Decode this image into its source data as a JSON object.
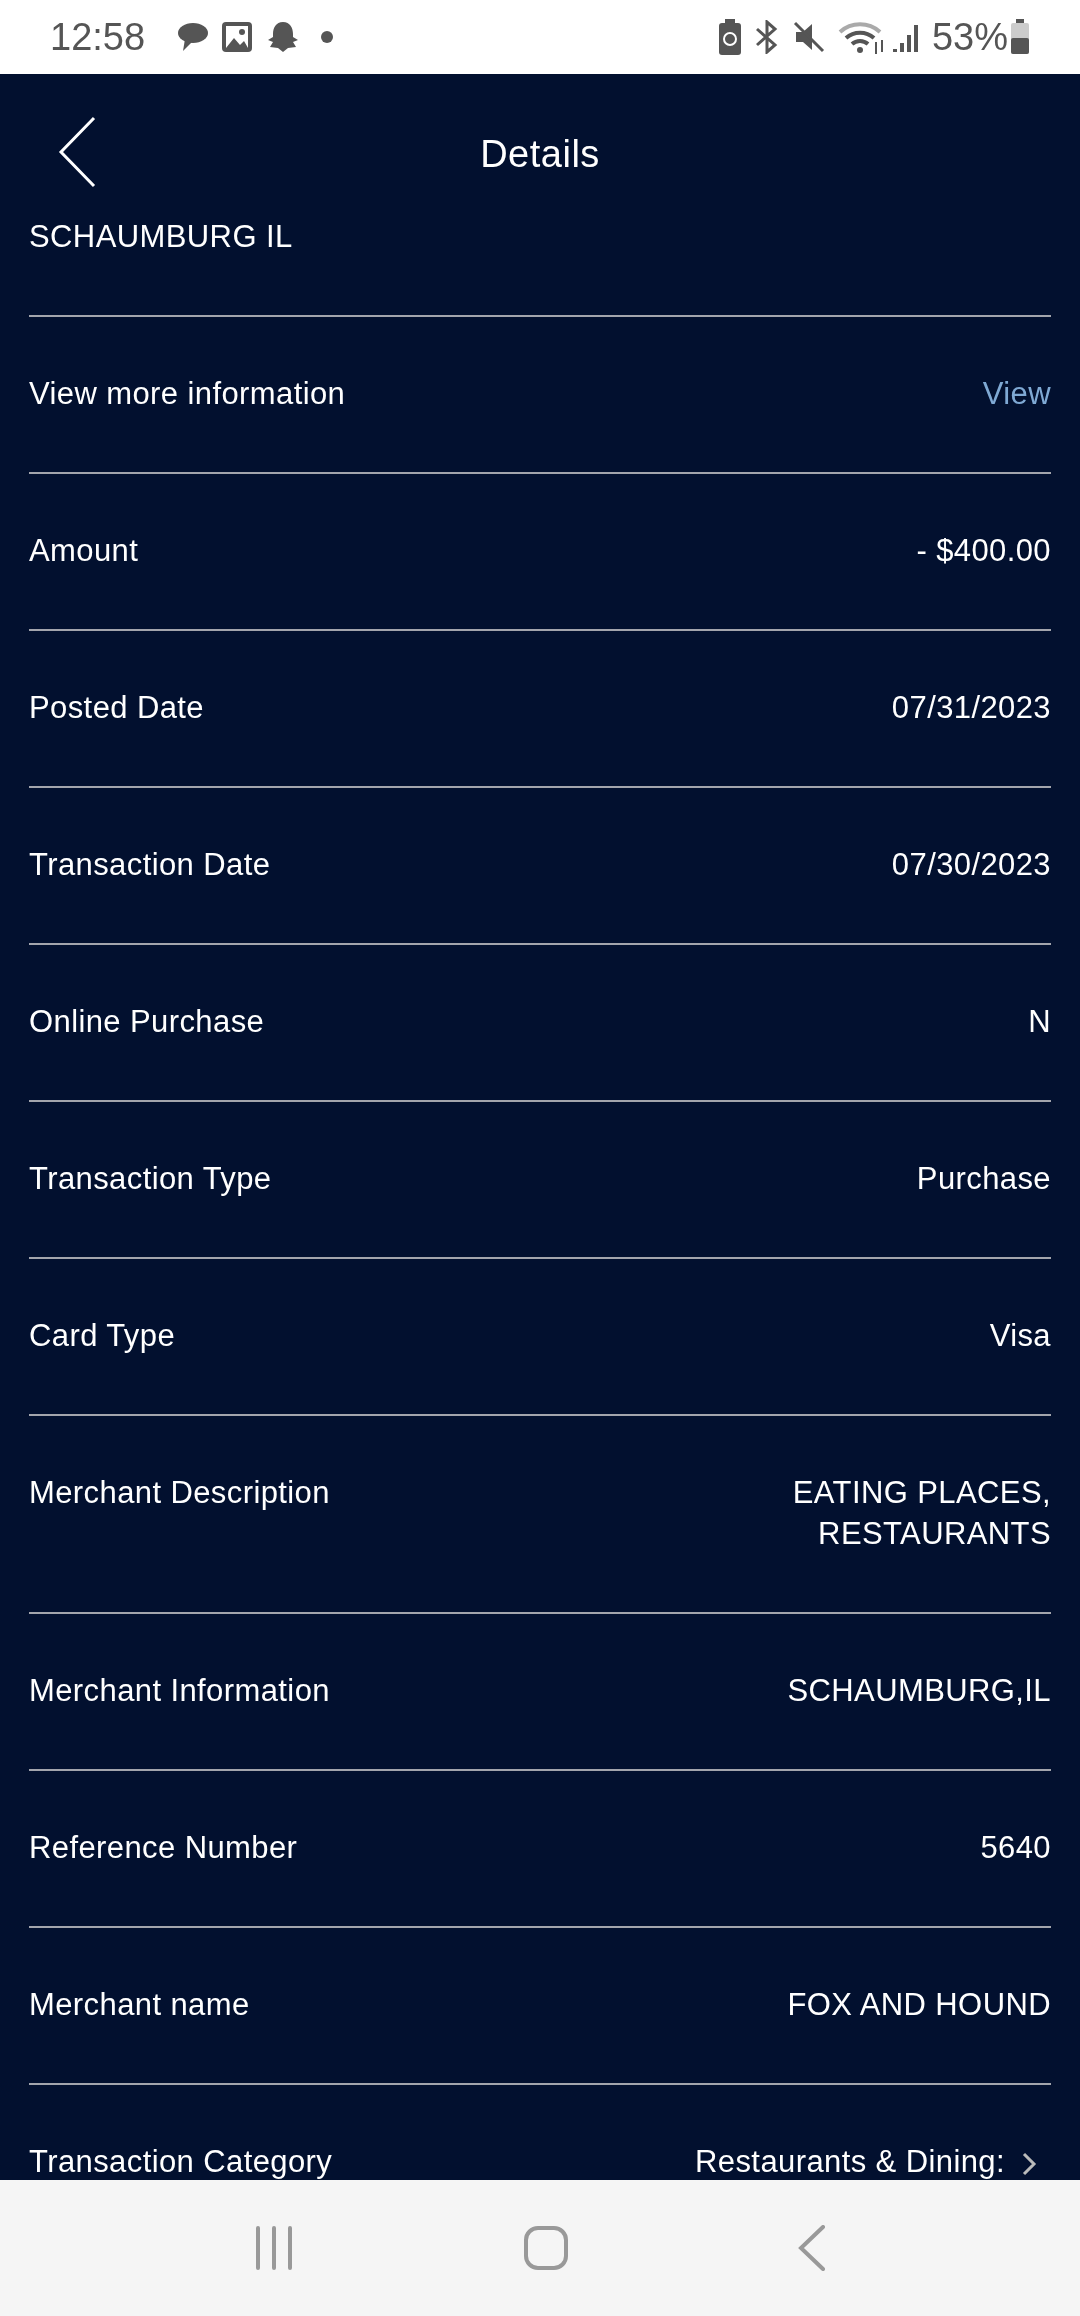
{
  "status_bar": {
    "time": "12:58",
    "battery": "53%"
  },
  "header": {
    "title": "Details"
  },
  "rows": [
    {
      "kind": "continuation",
      "value": "SCHAUMBURG IL"
    },
    {
      "kind": "link",
      "label": "View more information",
      "value": "View"
    },
    {
      "kind": "text",
      "label": "Amount",
      "value": "- $400.00"
    },
    {
      "kind": "text",
      "label": "Posted Date",
      "value": "07/31/2023"
    },
    {
      "kind": "text",
      "label": "Transaction Date",
      "value": "07/30/2023"
    },
    {
      "kind": "text",
      "label": "Online Purchase",
      "value": "N"
    },
    {
      "kind": "text",
      "label": "Transaction Type",
      "value": "Purchase"
    },
    {
      "kind": "text",
      "label": "Card Type",
      "value": "Visa"
    },
    {
      "kind": "text",
      "label": "Merchant Description",
      "value": "EATING PLACES, RESTAURANTS"
    },
    {
      "kind": "text",
      "label": "Merchant Information",
      "value": "SCHAUMBURG,IL"
    },
    {
      "kind": "text",
      "label": "Reference Number",
      "value": "5640"
    },
    {
      "kind": "text",
      "label": "Merchant name",
      "value": "FOX AND HOUND"
    },
    {
      "kind": "chevron",
      "label": "Transaction Category",
      "value": "Restaurants & Dining:"
    }
  ]
}
